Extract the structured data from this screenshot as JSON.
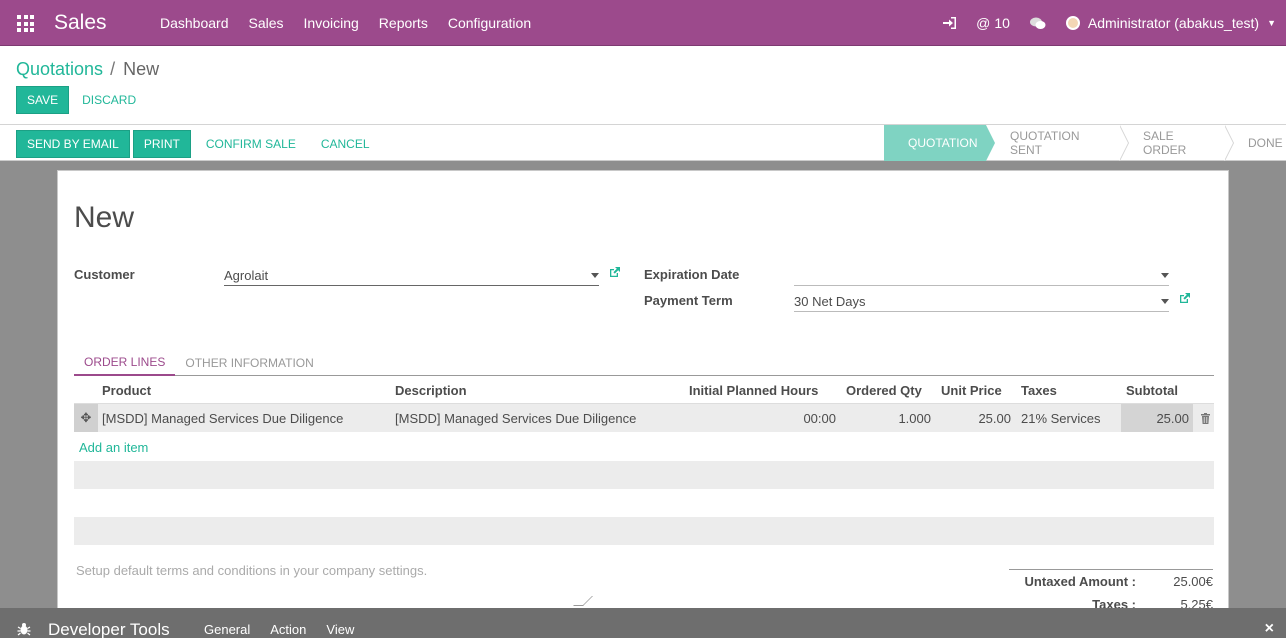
{
  "navbar": {
    "brand": "Sales",
    "menu": [
      "Dashboard",
      "Sales",
      "Invoicing",
      "Reports",
      "Configuration"
    ],
    "mentions_count": "10",
    "user": "Administrator (abakus_test)"
  },
  "breadcrumb": {
    "parent": "Quotations",
    "separator": "/",
    "current": "New"
  },
  "control_buttons": {
    "save": "Save",
    "discard": "Discard"
  },
  "statusbar": {
    "buttons": {
      "send_email": "Send by Email",
      "print": "Print",
      "confirm": "Confirm Sale",
      "cancel": "Cancel"
    },
    "stages": [
      "Quotation",
      "Quotation Sent",
      "Sale Order",
      "Done"
    ],
    "active_stage": "Quotation"
  },
  "form": {
    "title": "New",
    "customer_label": "Customer",
    "customer_value": "Agrolait",
    "expiration_label": "Expiration Date",
    "expiration_value": "",
    "payment_term_label": "Payment Term",
    "payment_term_value": "30 Net Days",
    "tabs": [
      "Order Lines",
      "Other Information"
    ],
    "active_tab": "Order Lines",
    "columns": {
      "product": "Product",
      "description": "Description",
      "hours": "Initial Planned Hours",
      "qty": "Ordered Qty",
      "price": "Unit Price",
      "taxes": "Taxes",
      "subtotal": "Subtotal"
    },
    "lines": [
      {
        "product": "[MSDD] Managed Services Due Diligence",
        "description": "[MSDD] Managed Services Due Diligence",
        "hours": "00:00",
        "qty": "1.000",
        "price": "25.00",
        "taxes": "21% Services",
        "subtotal": "25.00"
      }
    ],
    "add_item": "Add an item",
    "terms_placeholder": "Setup default terms and conditions in your company settings.",
    "totals": {
      "untaxed_label": "Untaxed Amount :",
      "untaxed_value": "25.00€",
      "taxes_label": "Taxes :",
      "taxes_value": "5.25€"
    }
  },
  "devtools": {
    "title": "Developer Tools",
    "menu": [
      "General",
      "Action",
      "View"
    ],
    "close": "×"
  },
  "colors": {
    "brand": "#9c4a8c",
    "accent": "#21b799",
    "active_stage": "#7fd3c2"
  }
}
